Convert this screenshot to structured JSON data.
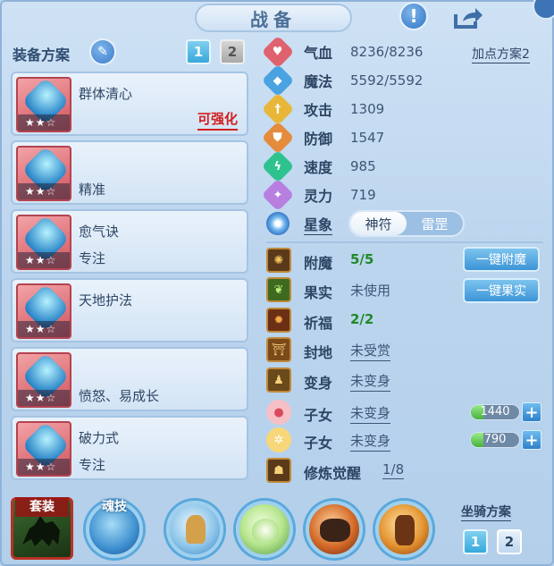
{
  "header": {
    "title": "战备"
  },
  "equipment": {
    "title": "装备方案",
    "scheme_buttons": [
      "1",
      "2"
    ],
    "items": [
      {
        "name": "群体清心",
        "status": "可强化",
        "stars": "★★☆"
      },
      {
        "name": "精准",
        "stars": "★★☆"
      },
      {
        "name": "愈气诀",
        "sub": "专注",
        "stars": "★★☆"
      },
      {
        "name": "天地护法",
        "stars": "★★☆"
      },
      {
        "name": "愤怒、易成长",
        "stars": "★★☆"
      },
      {
        "name": "破力式",
        "sub": "专注",
        "stars": "★★☆"
      }
    ]
  },
  "stats": {
    "plan_link": "加点方案2",
    "rows": [
      {
        "label": "气血",
        "value": "8236/8236",
        "icon": "heart-icon",
        "color": "#e0626f"
      },
      {
        "label": "魔法",
        "value": "5592/5592",
        "icon": "mana-icon",
        "color": "#4aa3e0"
      },
      {
        "label": "攻击",
        "value": "1309",
        "icon": "sword-icon",
        "color": "#e8b73a"
      },
      {
        "label": "防御",
        "value": "1547",
        "icon": "shield-icon",
        "color": "#e58b3c"
      },
      {
        "label": "速度",
        "value": "985",
        "icon": "lightning-icon",
        "color": "#2ec28f"
      },
      {
        "label": "灵力",
        "value": "719",
        "icon": "spirit-icon",
        "color": "#b77fe0"
      }
    ],
    "star_label": "星象",
    "star_options": [
      "神符",
      "雷罡"
    ]
  },
  "features": {
    "rows": [
      {
        "label": "附魔",
        "value": "5/5"
      },
      {
        "label": "果实",
        "value": "未使用"
      },
      {
        "label": "祈福",
        "value": "2/2"
      },
      {
        "label": "封地",
        "value": "未受赏"
      },
      {
        "label": "变身",
        "value": "未变身"
      },
      {
        "label": "子女",
        "value": "未变身"
      },
      {
        "label": "子女",
        "value": "未变身"
      },
      {
        "label": "修炼觉醒",
        "value": "1/8"
      }
    ],
    "enchant_button": "一键附魔",
    "fruit_button": "一键果实",
    "child_bars": [
      "1440",
      "790"
    ]
  },
  "bottom": {
    "suit_label": "套装",
    "soul_label": "魂技",
    "mount_title": "坐骑方案",
    "mount_buttons": [
      "1",
      "2"
    ]
  }
}
